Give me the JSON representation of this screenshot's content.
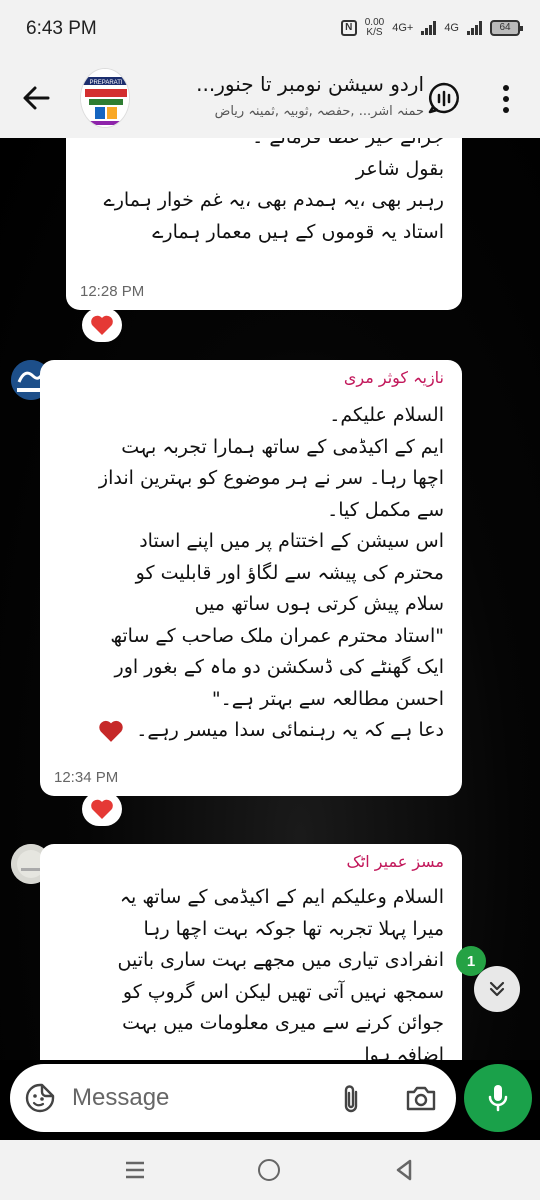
{
  "status_bar": {
    "time": "6:43 PM",
    "nfc": "N",
    "speed_value": "0.00",
    "speed_unit": "K/S",
    "net1": "4G+",
    "net2": "4G",
    "battery": "64"
  },
  "header": {
    "title": "اردو سیشن نومبر تا جنور...",
    "members": "حمنہ اشر... ,حفصہ ,ثوبیہ ,ثمینہ ریاض",
    "avatar_text": "PREPARATI"
  },
  "messages": [
    {
      "lines": [
        "جزائے خیر عطا فرمائے ۔",
        "بقول شاعر",
        "رہبر بھی ،یہ ہمدم بھی ،یہ غم خوار ہمارے",
        "استاد یہ قوموں کے ہیں معمار ہمارے"
      ],
      "time": "12:28 PM",
      "reaction": "heart"
    },
    {
      "sender": "نازیہ کوثر مری",
      "sender_color": "#c2185b",
      "lines": [
        "السلام علیکم۔",
        "ایم کے اکیڈمی کے ساتھ ہمارا تجربہ بہت",
        "اچھا رہا۔ سر نے ہر موضوع کو بہترین انداز",
        "سے مکمل کیا۔",
        "اس سیشن کے اختتام پر میں اپنے استاد",
        "محترم کی پیشہ سے لگاؤ اور قابلیت کو",
        "سلام پیش کرتی ہوں ساتھ میں",
        "\"استاد محترم عمران ملک صاحب کے ساتھ",
        "ایک گھنٹے کی ڈسکشن دو ماہ کے بغور اور",
        "احسن مطالعہ سے بہتر ہے۔\"",
        "دعا ہے کہ یہ رہنمائی سدا میسر رہے۔"
      ],
      "time": "12:34 PM",
      "reaction": "heart"
    },
    {
      "sender": "مسز عمیر اٹک",
      "sender_color": "#c2185b",
      "lines": [
        "السلام وعلیکم ایم کے اکیڈمی کے ساتھ یہ",
        "میرا پہلا تجربہ تھا جوکہ بہت اچھا رہا",
        "انفرادی تیاری میں مجھے بہت ساری باتیں",
        "سمجھ نہیں آتی تھیں لیکن اس گروپ کو",
        "جوائن کرنے سے میری معلومات میں بہت",
        "اضافہ ہوا"
      ]
    }
  ],
  "scroll": {
    "unread_count": "1"
  },
  "composer": {
    "placeholder": "Message"
  },
  "icons": {
    "back": "arrow-left-icon",
    "voice_chat": "voice-chat-icon",
    "more": "more-vert-icon",
    "emoji": "sticker-emoji-icon",
    "attach": "paperclip-icon",
    "camera": "camera-icon",
    "mic": "microphone-icon",
    "scroll_down": "chevrons-down-icon"
  },
  "colors": {
    "accent_green": "#1aa14a",
    "heart_red": "#e53935",
    "sender_name": "#c2185b"
  }
}
